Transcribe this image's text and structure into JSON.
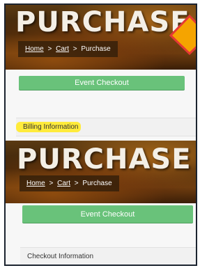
{
  "top_banner": {
    "title": "PURCHASE",
    "breadcrumb": {
      "home": "Home",
      "sep1": ">",
      "cart": "Cart",
      "sep2": ">",
      "current": "Purchase"
    }
  },
  "top_button": {
    "label": "Event Checkout"
  },
  "top_section": {
    "title": "Billing Information"
  },
  "bottom_banner": {
    "title": "PURCHASE",
    "breadcrumb": {
      "home": "Home",
      "sep1": ">",
      "cart": "Cart",
      "sep2": ">",
      "current": "Purchase"
    }
  },
  "bottom_button": {
    "label": "Event Checkout"
  },
  "bottom_section": {
    "title": "Checkout Information"
  },
  "colors": {
    "accent_green": "#69c27a",
    "highlight_yellow": "#ffeb3b",
    "warning_orange": "#f5a400",
    "warning_red": "#e53935"
  },
  "icons": {
    "warning": "warning-icon"
  }
}
